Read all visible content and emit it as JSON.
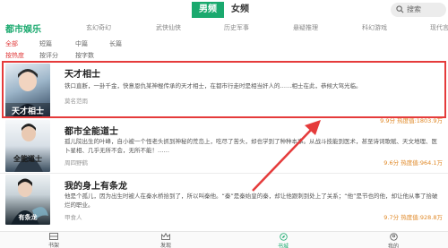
{
  "header": {
    "tabs": [
      "男频",
      "女频"
    ],
    "search_label": "搜索"
  },
  "categories": [
    "都市娱乐",
    "玄幻奇幻",
    "武侠仙侠",
    "历史军事",
    "悬疑推理",
    "科幻游戏",
    "现代言"
  ],
  "filters_row1": [
    "全部",
    "短篇",
    "中篇",
    "长篇"
  ],
  "filters_row2": [
    "按热度",
    "按评分",
    "按字数"
  ],
  "books": [
    {
      "title": "天才相士",
      "desc": "铁口直断，一卦千金，快意恩仇某神棍传承的天才相士，在都市行走时是相当奸人的……相士在此，恭候大驾光临。",
      "author": "莫名范雨",
      "score": "9.9分",
      "heat": "热度值:1803.9万",
      "cover_text": "天才相士"
    },
    {
      "title": "都市全能道士",
      "desc": "孤儿院出生的叶峰，自小被一个怪老头抓到神秘的荒岛上，吃尽了苦头，却也学到了种种本事。从战斗技能到医术，甚至诗词歌赋、天文地理、医卜星相、几乎无所不会，无所不能！……",
      "author": "周四野鹤",
      "score": "9.6分",
      "heat": "热度值:964.1万",
      "cover_text": "全能道士"
    },
    {
      "title": "我的身上有条龙",
      "desc": "他是个孤儿，因为出生时被人在秦水桥拾到了，所以叫秦他。“秦”是秦始皇的秦，却让他跟刺到处上了关系；“他”是节也的他，却让他从事了拾破烂的职业。",
      "author": "甲食人",
      "score": "9.7分",
      "heat": "热度值:928.8万",
      "cover_text": "有条龙"
    }
  ],
  "bottom_nav": [
    "书架",
    "发现",
    "书城",
    "我的"
  ]
}
